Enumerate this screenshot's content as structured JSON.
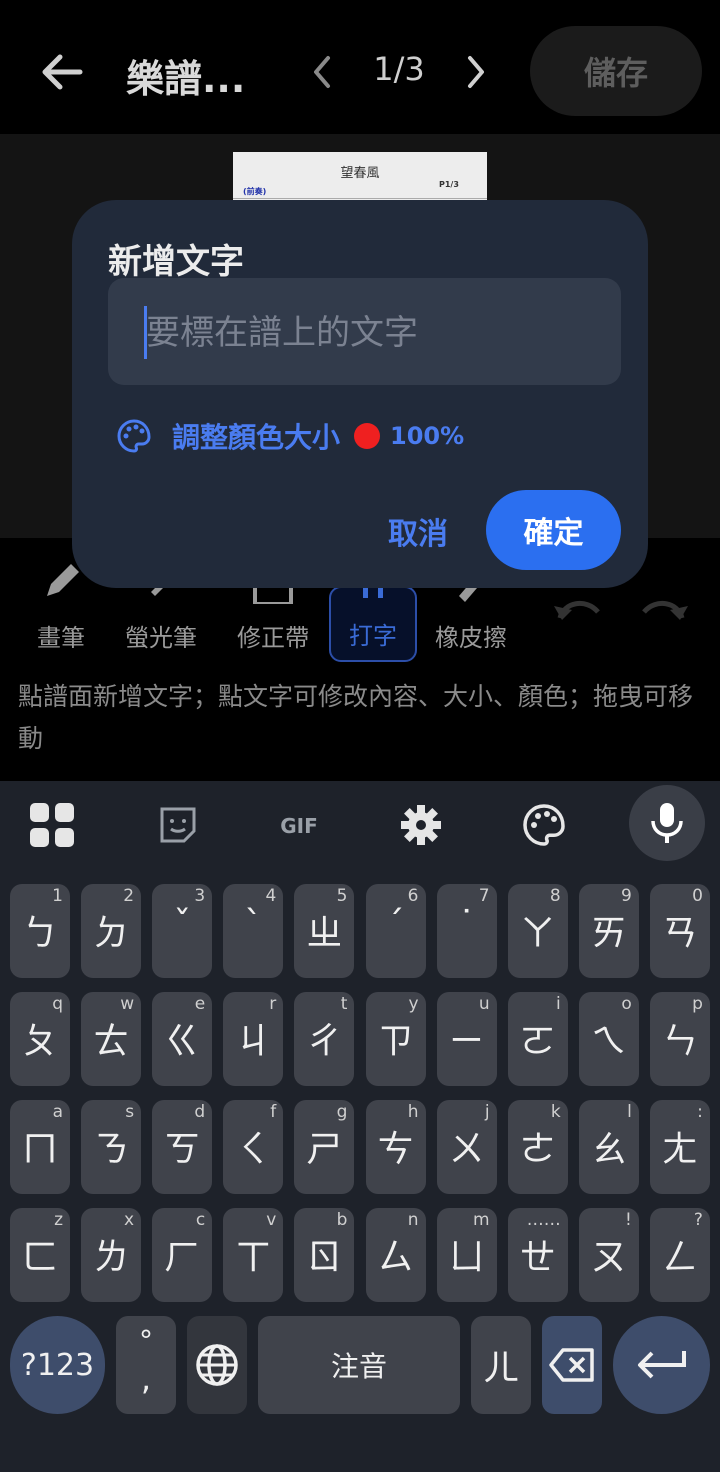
{
  "topbar": {
    "title": "樂譜...",
    "pager": "1/3",
    "save_label": "儲存"
  },
  "score": {
    "title": "望春風",
    "section": "(前奏)",
    "page": "P1/3"
  },
  "tools": [
    {
      "label": "畫筆",
      "icon": "pencil-icon"
    },
    {
      "label": "螢光筆",
      "icon": "highlighter-icon"
    },
    {
      "label": "修正帶",
      "icon": "correction-tape-icon"
    },
    {
      "label": "打字",
      "icon": "text-icon",
      "active": true
    },
    {
      "label": "橡皮擦",
      "icon": "eraser-icon"
    }
  ],
  "hint": "點譜面新增文字；點文字可修改內容、大小、顏色；拖曳可移動",
  "dialog": {
    "title": "新增文字",
    "placeholder": "要標在譜上的文字",
    "adjust_label": "調整顏色大小",
    "size": "100%",
    "color": "#ef2020",
    "cancel": "取消",
    "ok": "確定"
  },
  "keyboard": {
    "rows": [
      [
        {
          "k": "ㄅ",
          "h": "1"
        },
        {
          "k": "ㄉ",
          "h": "2"
        },
        {
          "k": "ˇ",
          "h": "3"
        },
        {
          "k": "ˋ",
          "h": "4"
        },
        {
          "k": "ㄓ",
          "h": "5"
        },
        {
          "k": "ˊ",
          "h": "6"
        },
        {
          "k": "˙",
          "h": "7"
        },
        {
          "k": "ㄚ",
          "h": "8"
        },
        {
          "k": "ㄞ",
          "h": "9"
        },
        {
          "k": "ㄢ",
          "h": "0"
        }
      ],
      [
        {
          "k": "ㄆ",
          "h": "q"
        },
        {
          "k": "ㄊ",
          "h": "w"
        },
        {
          "k": "ㄍ",
          "h": "e"
        },
        {
          "k": "ㄐ",
          "h": "r"
        },
        {
          "k": "ㄔ",
          "h": "t"
        },
        {
          "k": "ㄗ",
          "h": "y"
        },
        {
          "k": "ㄧ",
          "h": "u"
        },
        {
          "k": "ㄛ",
          "h": "i"
        },
        {
          "k": "ㄟ",
          "h": "o"
        },
        {
          "k": "ㄣ",
          "h": "p"
        }
      ],
      [
        {
          "k": "ㄇ",
          "h": "a"
        },
        {
          "k": "ㄋ",
          "h": "s"
        },
        {
          "k": "ㄎ",
          "h": "d"
        },
        {
          "k": "ㄑ",
          "h": "f"
        },
        {
          "k": "ㄕ",
          "h": "g"
        },
        {
          "k": "ㄘ",
          "h": "h"
        },
        {
          "k": "ㄨ",
          "h": "j"
        },
        {
          "k": "ㄜ",
          "h": "k"
        },
        {
          "k": "ㄠ",
          "h": "l"
        },
        {
          "k": "ㄤ",
          "h": ":"
        }
      ],
      [
        {
          "k": "ㄈ",
          "h": "z"
        },
        {
          "k": "ㄌ",
          "h": "x"
        },
        {
          "k": "ㄏ",
          "h": "c"
        },
        {
          "k": "ㄒ",
          "h": "v"
        },
        {
          "k": "ㄖ",
          "h": "b"
        },
        {
          "k": "ㄙ",
          "h": "n"
        },
        {
          "k": "ㄩ",
          "h": "m"
        },
        {
          "k": "ㄝ",
          "h": "……"
        },
        {
          "k": "ㄡ",
          "h": "!"
        },
        {
          "k": "ㄥ",
          "h": "?"
        }
      ]
    ],
    "symbols": "?123",
    "punct_top": "°",
    "punct_bottom": ",",
    "space": "注音",
    "er": "ㄦ"
  }
}
